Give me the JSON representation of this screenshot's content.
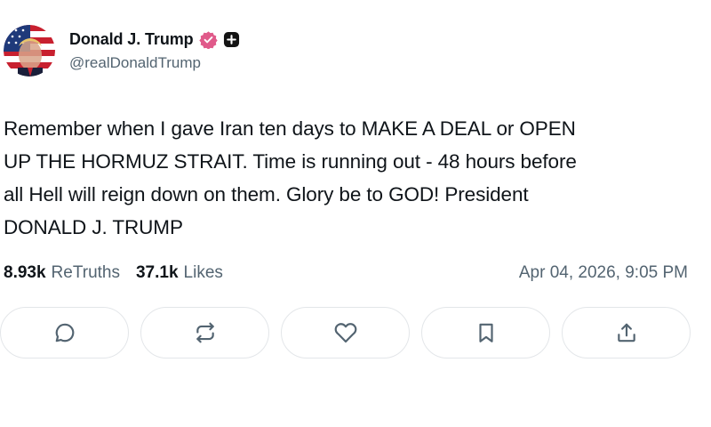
{
  "author": {
    "display_name": "Donald J. Trump",
    "handle": "@realDonaldTrump",
    "avatar_icon": "avatar-photo-flag",
    "verified_icon": "verified-badge-icon",
    "verified_color": "#e05a8a",
    "extra_badge_icon": "plus-badge-icon"
  },
  "post": {
    "text": "Remember when I gave Iran ten days to MAKE A DEAL or OPEN\nUP THE HORMUZ STRAIT. Time is running out - 48 hours before\nall Hell will reign down on them. Glory be to GOD! President\nDONALD J. TRUMP"
  },
  "stats": {
    "retruths_count": "8.93k",
    "retruths_label": "ReTruths",
    "likes_count": "37.1k",
    "likes_label": "Likes"
  },
  "timestamp": "Apr 04, 2026, 9:05 PM",
  "actions": [
    {
      "name": "reply",
      "icon": "comment-icon"
    },
    {
      "name": "retruth",
      "icon": "repost-icon"
    },
    {
      "name": "like",
      "icon": "heart-icon"
    },
    {
      "name": "bookmark",
      "icon": "bookmark-icon"
    },
    {
      "name": "share",
      "icon": "share-icon"
    }
  ],
  "colors": {
    "text": "#0f1419",
    "muted": "#536471",
    "button_border": "#e3e6e9"
  }
}
